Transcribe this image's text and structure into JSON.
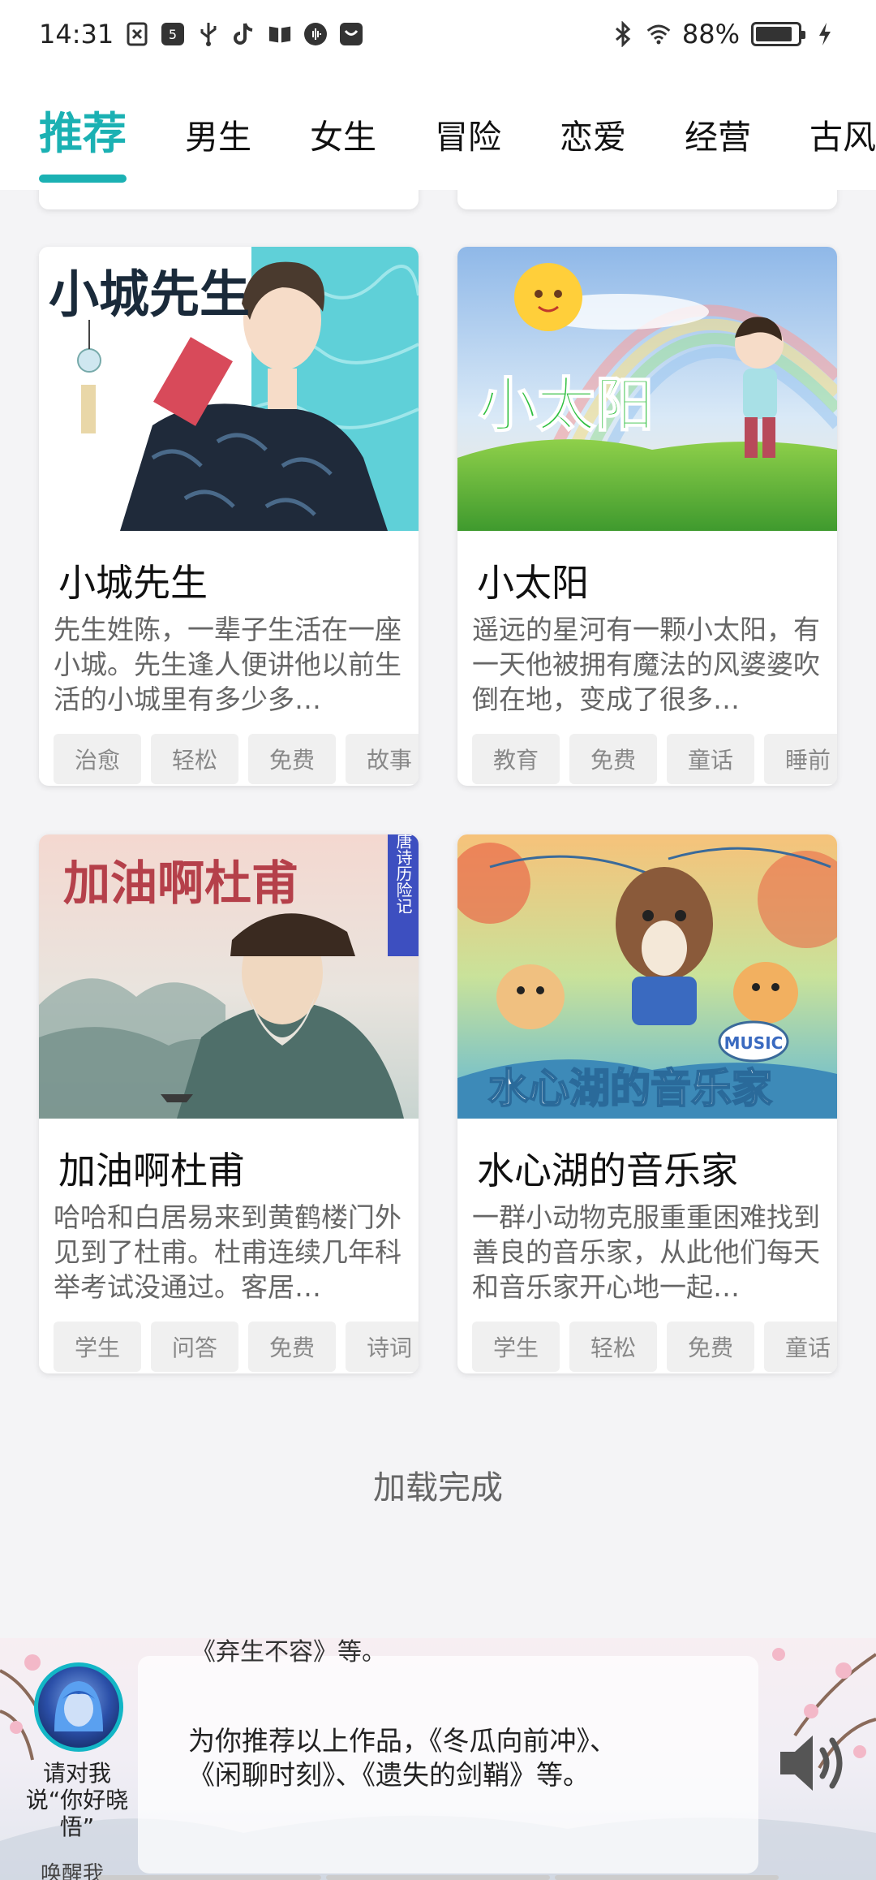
{
  "status": {
    "time": "14:31",
    "battery": "88%",
    "battery_level": 0.88
  },
  "tabs": [
    {
      "label": "推荐",
      "active": true
    },
    {
      "label": "男生"
    },
    {
      "label": "女生"
    },
    {
      "label": "冒险"
    },
    {
      "label": "恋爱"
    },
    {
      "label": "经营"
    },
    {
      "label": "古风"
    }
  ],
  "cards": [
    {
      "title": "小城先生",
      "cover_text": "小城先生",
      "desc": "先生姓陈，一辈子生活在一座小城。先生逢人便讲他以前生活的小城里有多少多…",
      "tags": [
        "治愈",
        "轻松",
        "免费",
        "故事"
      ]
    },
    {
      "title": "小太阳",
      "cover_text": "小太阳",
      "desc": "遥远的星河有一颗小太阳，有一天他被拥有魔法的风婆婆吹倒在地，变成了很多…",
      "tags": [
        "教育",
        "免费",
        "童话",
        "睡前"
      ]
    },
    {
      "title": "加油啊杜甫",
      "cover_text": "加油啊杜甫",
      "cover_badge": "哈哈唐诗历险记",
      "desc": "哈哈和白居易来到黄鹤楼门外见到了杜甫。杜甫连续几年科举考试没通过。客居…",
      "tags": [
        "学生",
        "问答",
        "免费",
        "诗词"
      ]
    },
    {
      "title": "水心湖的音乐家",
      "cover_text": "水心湖的音乐家",
      "cover_badge": "MUSIC",
      "desc": "一群小动物克服重重困难找到善良的音乐家，从此他们每天和音乐家开心地一起…",
      "tags": [
        "学生",
        "轻松",
        "免费",
        "童话"
      ]
    }
  ],
  "footer": {
    "loaded": "加载完成"
  },
  "assistant": {
    "prev_text": "《弃生不容》等。",
    "message": "为你推荐以上作品，《冬瓜向前冲》、《闲聊时刻》、《遗失的剑鞘》等。",
    "wake_hint": "请对我说“你好晓悟”",
    "wake_hint_cut": "唤醒我"
  }
}
